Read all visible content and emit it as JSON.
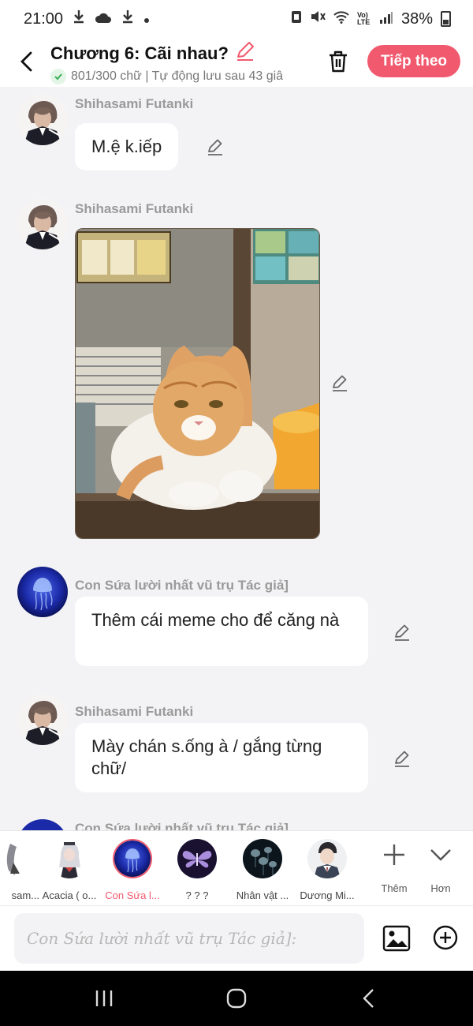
{
  "status_bar": {
    "time": "21:00",
    "battery": "38%",
    "network": "Vo) LTE"
  },
  "header": {
    "back_icon": "chevron-left-icon",
    "title": "Chương 6: Cãi nhau?",
    "subtitle": "801/300 chữ | Tự động lưu sau 43 giâ",
    "next_label": "Tiếp theo",
    "accent_color": "#f15a6e"
  },
  "messages": [
    {
      "sender": "Shihasami Futanki",
      "type": "text",
      "text": "M.ệ k.iếp"
    },
    {
      "sender": "Shihasami Futanki",
      "type": "image",
      "image_desc": "grumpy-cat-meme"
    },
    {
      "sender": "Con Sứa lười nhất vũ trụ Tác giả]",
      "type": "text",
      "text": "Thêm cái meme cho để căng nà"
    },
    {
      "sender": "Shihasami Futanki",
      "type": "text",
      "text": "Mày chán s.ống à / gắng từng chữ/"
    },
    {
      "sender": "Con Sứa lười nhất vũ trụ Tác giả]",
      "type": "text",
      "text": ""
    }
  ],
  "characters": [
    {
      "name": "sam..."
    },
    {
      "name": "Acacia ( o..."
    },
    {
      "name": "Con Sứa l...",
      "active": true
    },
    {
      "name": "? ? ?"
    },
    {
      "name": "Nhân vật ..."
    },
    {
      "name": "Dương Mi..."
    }
  ],
  "tools": {
    "add_label": "Thêm",
    "more_label": "Hơn"
  },
  "input": {
    "placeholder": "Con Sứa lười nhất vũ trụ Tác giả]:"
  }
}
